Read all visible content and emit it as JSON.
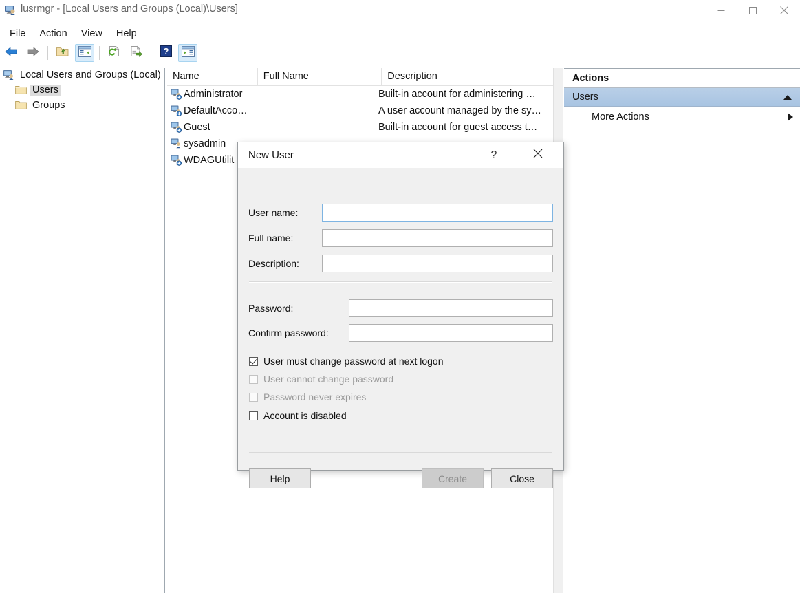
{
  "window": {
    "title": "lusrmgr - [Local Users and Groups (Local)\\Users]",
    "icon": "computer-users-icon",
    "minimize_label": "—",
    "maximize_label": "□",
    "close_label": "✕"
  },
  "menubar": {
    "items": [
      {
        "label": "File"
      },
      {
        "label": "Action"
      },
      {
        "label": "View"
      },
      {
        "label": "Help"
      }
    ]
  },
  "toolbar": {
    "buttons": [
      {
        "name": "back-icon",
        "title": "Back",
        "active": false
      },
      {
        "name": "forward-icon",
        "title": "Forward",
        "active": false
      },
      {
        "name": "up-folder-icon",
        "title": "Up One Level",
        "active": false
      },
      {
        "name": "show-hide-tree-icon",
        "title": "Show/Hide Console Tree",
        "active": true
      },
      {
        "name": "refresh-icon",
        "title": "Refresh",
        "active": false
      },
      {
        "name": "export-list-icon",
        "title": "Export List",
        "active": false
      },
      {
        "name": "help-icon",
        "title": "Help",
        "active": false
      },
      {
        "name": "show-action-pane-icon",
        "title": "Show/Hide Action Pane",
        "active": true
      }
    ]
  },
  "tree": {
    "root": {
      "label": "Local Users and Groups (Local)",
      "icon": "computer-icon"
    },
    "children": [
      {
        "label": "Users",
        "icon": "folder-icon",
        "selected": true
      },
      {
        "label": "Groups",
        "icon": "folder-icon",
        "selected": false
      }
    ]
  },
  "list": {
    "columns": [
      {
        "label": "Name"
      },
      {
        "label": "Full Name"
      },
      {
        "label": "Description"
      }
    ],
    "rows": [
      {
        "name": "Administrator",
        "full_name": "",
        "description": "Built-in account for administering …"
      },
      {
        "name": "DefaultAcco…",
        "full_name": "",
        "description": "A user account managed by the sy…"
      },
      {
        "name": "Guest",
        "full_name": "",
        "description": "Built-in account for guest access t…"
      },
      {
        "name": "sysadmin",
        "full_name": "",
        "description": ""
      },
      {
        "name": "WDAGUtilit",
        "full_name": "",
        "description": ""
      }
    ]
  },
  "actions": {
    "header": "Actions",
    "group": {
      "label": "Users",
      "collapse_icon": "triangle-up-icon"
    },
    "items": [
      {
        "label": "More Actions",
        "submenu_icon": "triangle-right-icon"
      }
    ]
  },
  "dialog": {
    "title": "New User",
    "help_label": "?",
    "close_label": "✕",
    "fields": [
      {
        "label": "User name:",
        "value": "",
        "focused": true
      },
      {
        "label": "Full name:",
        "value": "",
        "focused": false
      },
      {
        "label": "Description:",
        "value": "",
        "focused": false
      }
    ],
    "password_fields": [
      {
        "label": "Password:",
        "value": ""
      },
      {
        "label": "Confirm password:",
        "value": ""
      }
    ],
    "checkboxes": [
      {
        "label": "User must change password at next logon",
        "checked": true,
        "disabled": false
      },
      {
        "label": "User cannot change password",
        "checked": false,
        "disabled": true
      },
      {
        "label": "Password never expires",
        "checked": false,
        "disabled": true
      },
      {
        "label": "Account is disabled",
        "checked": false,
        "disabled": false
      }
    ],
    "buttons": [
      {
        "label": "Help",
        "disabled": false
      },
      {
        "label": "Create",
        "disabled": true
      },
      {
        "label": "Close",
        "disabled": false
      }
    ]
  },
  "colors": {
    "accent_selected": "#b9cfe7",
    "focus_border": "#7eb4e2",
    "dialog_bg": "#f0f0f0",
    "toolbar_active": "#d8ecfb"
  }
}
